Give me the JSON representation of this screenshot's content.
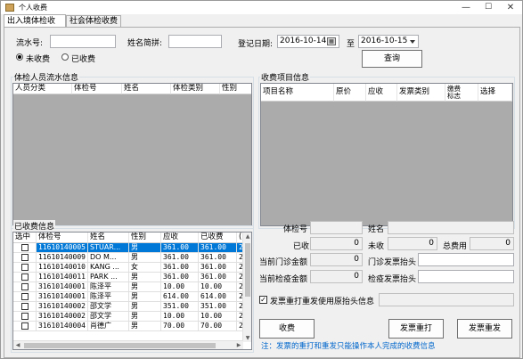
{
  "window": {
    "title": "个人收费",
    "minimize": "—",
    "maximize": "☐",
    "close": "✕"
  },
  "tabs": [
    {
      "label": "出入境体检收费"
    },
    {
      "label": "社会体检收费"
    }
  ],
  "filters": {
    "serial_label": "流水号:",
    "serial_value": "",
    "pinyin_label": "姓名简拼:",
    "pinyin_value": "",
    "regdate_label": "登记日期:",
    "date_from": "2016-10-14",
    "date_to_label": "至",
    "date_to": "2016-10-15",
    "radio_unpaid": "未收费",
    "radio_paid": "已收费",
    "selected_radio": "unpaid",
    "query_button": "查询"
  },
  "serial_group": {
    "title": "体检人员流水信息",
    "columns": [
      "人员分类",
      "体检号",
      "姓名",
      "体检类别",
      "性别"
    ]
  },
  "fee_group": {
    "title": "收费项目信息",
    "columns": [
      "项目名称",
      "原价",
      "应收",
      "发票类别",
      "缴费\n标志",
      "选择"
    ]
  },
  "paid_group": {
    "title": "已收费信息",
    "columns": [
      "选中",
      "体检号",
      "姓名",
      "性别",
      "应收",
      "已收费",
      "("
    ],
    "rows": [
      {
        "id": "11610140005",
        "name": "STUAR...",
        "sex": "男",
        "due": "361.00",
        "paid": "361.00",
        "x": "2",
        "selected": true
      },
      {
        "id": "11610140009",
        "name": "DO  M...",
        "sex": "男",
        "due": "361.00",
        "paid": "361.00",
        "x": "2",
        "selected": false
      },
      {
        "id": "11610140010",
        "name": "KANG ...",
        "sex": "女",
        "due": "361.00",
        "paid": "361.00",
        "x": "2",
        "selected": false
      },
      {
        "id": "11610140011",
        "name": "PARK ...",
        "sex": "男",
        "due": "361.00",
        "paid": "361.00",
        "x": "2",
        "selected": false
      },
      {
        "id": "31610140001",
        "name": "陈泽平",
        "sex": "男",
        "due": "10.00",
        "paid": "10.00",
        "x": "2",
        "selected": false
      },
      {
        "id": "31610140001",
        "name": "陈泽平",
        "sex": "男",
        "due": "614.00",
        "paid": "614.00",
        "x": "2",
        "selected": false
      },
      {
        "id": "31610140002",
        "name": "邵文学",
        "sex": "男",
        "due": "351.00",
        "paid": "351.00",
        "x": "2",
        "selected": false
      },
      {
        "id": "31610140002",
        "name": "邵文学",
        "sex": "男",
        "due": "10.00",
        "paid": "10.00",
        "x": "2",
        "selected": false
      },
      {
        "id": "31610140004",
        "name": "肖德广",
        "sex": "男",
        "due": "70.00",
        "paid": "70.00",
        "x": "2",
        "selected": false
      }
    ]
  },
  "details": {
    "exam_no_label": "体检号",
    "exam_no_value": "",
    "name_label": "姓名",
    "name_value": "",
    "paid_label": "已收",
    "paid_value": "0",
    "unpaid_label": "未收",
    "unpaid_value": "0",
    "total_label": "总费用",
    "total_value": "0",
    "clinic_amount_label": "当前门诊金额",
    "clinic_amount_value": "0",
    "clinic_invoice_label": "门诊发票抬头",
    "clinic_invoice_value": "",
    "exam_amount_label": "当前检疫金额",
    "exam_amount_value": "0",
    "exam_invoice_label": "检疫发票抬头",
    "exam_invoice_value": "",
    "reprint_checkbox": "发票重打重发使用原抬头信息",
    "reprint_checked": true,
    "reprint_value": ""
  },
  "actions": {
    "charge": "收费",
    "reprint": "发票重打",
    "resend": "发票重发",
    "note": "注：发票的重打和重发只能操作本人完成的收费信息"
  }
}
